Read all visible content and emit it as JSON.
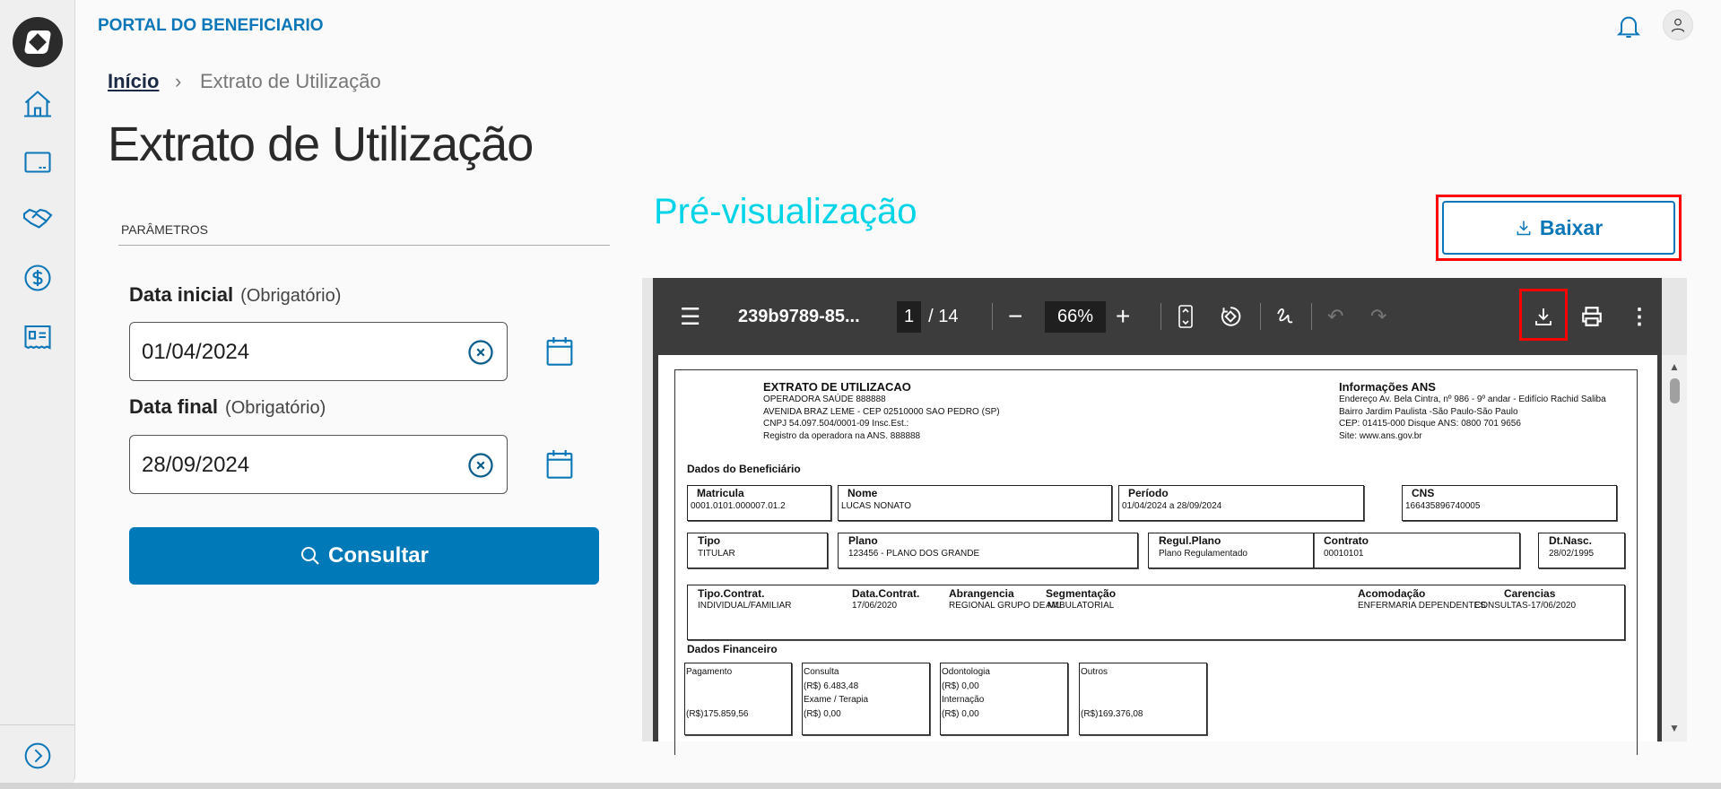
{
  "header": {
    "portal_title": "PORTAL DO BENEFICIARIO",
    "icons": [
      "bell-icon",
      "user-icon"
    ]
  },
  "sidebar": {
    "items": [
      "home-icon",
      "card-icon",
      "handshake-icon",
      "dollar-icon",
      "receipt-icon"
    ],
    "expand": "chevron-right-icon"
  },
  "breadcrumb": {
    "home": "Início",
    "current": "Extrato de Utilização"
  },
  "page_title": "Extrato de Utilização",
  "params": {
    "section": "PARÂMETROS",
    "start": {
      "label": "Data inicial",
      "hint": "(Obrigatório)",
      "value": "01/04/2024"
    },
    "end": {
      "label": "Data final",
      "hint": "(Obrigatório)",
      "value": "28/09/2024"
    },
    "submit": "Consultar"
  },
  "preview": {
    "title": "Pré-visualização",
    "download": "Baixar"
  },
  "colors": {
    "primary": "#0079b8",
    "preview_title": "#00d4e6",
    "highlight": "#ff0000"
  },
  "viewer": {
    "filename": "239b9789-85...",
    "page": "1",
    "pages": "/ 14",
    "zoom": "66%"
  },
  "pdf": {
    "title": "EXTRATO DE UTILIZACAO",
    "operator": [
      "OPERADORA SAÚDE 888888",
      "AVENIDA BRAZ LEME - CEP 02510000 SAO PEDRO (SP)",
      "CNPJ 54.097.504/0001-09  Insc.Est.:",
      "Registro da operadora na ANS. 888888"
    ],
    "ans_title": "Informações ANS",
    "ans": [
      "Endereço Av. Bela Cintra, nº 986 - 9º andar - Edifício Rachid Saliba",
      "Bairro Jardim Paulista -São Paulo-São Paulo",
      "CEP: 01415-000 Disque ANS: 0800 701 9656",
      "Site: www.ans.gov.br"
    ],
    "benef_title": "Dados do Beneficiário",
    "row1": [
      {
        "k": "Matricula",
        "v": "0001.0101.000007.01.2"
      },
      {
        "k": "Nome",
        "v": "LUCAS NONATO"
      },
      {
        "k": "Período",
        "v": "01/04/2024 a 28/09/2024"
      },
      {
        "k": "CNS",
        "v": "166435896740005"
      }
    ],
    "row2": [
      {
        "k": "Tipo",
        "v": "TITULAR"
      },
      {
        "k": "Plano",
        "v": "123456      - PLANO DOS GRANDE"
      },
      {
        "k": "Regul.Plano",
        "v": "Plano Regulamentado"
      },
      {
        "k": "Contrato",
        "v": "00010101"
      },
      {
        "k": "Dt.Nasc.",
        "v": "28/02/1995"
      }
    ],
    "row3": [
      {
        "k": "Tipo.Contrat.",
        "v": "INDIVIDUAL/FAMILIAR"
      },
      {
        "k": "Data.Contrat.",
        "v": "17/06/2020"
      },
      {
        "k": "Abrangencia",
        "v": "REGIONAL GRUPO DE MU"
      },
      {
        "k": "Segmentação",
        "v": "AMBULATORIAL"
      },
      {
        "k": "Acomodação",
        "v": "ENFERMARIA DEPENDENTES"
      },
      {
        "k": "Carencias",
        "v": "CONSULTAS-17/06/2020"
      }
    ],
    "fin_title": "Dados Financeiro",
    "fin": [
      {
        "lines": [
          "Pagamento",
          "",
          "",
          "(R$)175.859,56"
        ]
      },
      {
        "lines": [
          "Consulta",
          "(R$)  6.483,48",
          "Exame / Terapia",
          "(R$)      0,00"
        ]
      },
      {
        "lines": [
          "Odontologia",
          "(R$)      0,00",
          "Internação",
          "(R$)      0,00"
        ]
      },
      {
        "lines": [
          "Outros",
          "",
          "",
          "(R$)169.376,08"
        ]
      }
    ]
  }
}
